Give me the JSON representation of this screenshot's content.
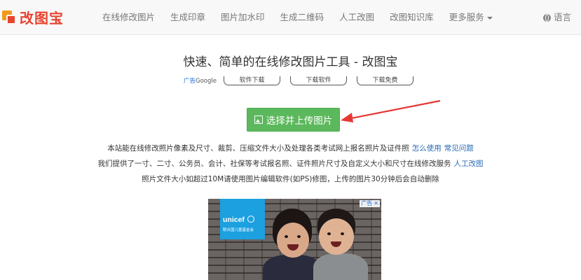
{
  "brand": {
    "logo_text": "改图宝",
    "logo_colors": [
      "#f39a1c",
      "#e8442f"
    ]
  },
  "nav": {
    "items": [
      "在线修改图片",
      "生成印章",
      "图片加水印",
      "生成二维码",
      "人工改图",
      "改图知识库",
      "更多服务"
    ],
    "language": "语言",
    "language_icon": "globe-icon"
  },
  "hero": {
    "title": "快速、简单的在线修改图片工具 - 改图宝"
  },
  "ads_row": {
    "google_prefix": "广告",
    "google_label": "Google",
    "pills": [
      "软件下载",
      "下载软件",
      "下载免费"
    ]
  },
  "upload": {
    "label": "选择并上传图片",
    "icon": "image-icon",
    "color": "#5cb85c"
  },
  "arrow_color": "#e53935",
  "info": {
    "line1_text": "本站能在线修改照片像素及尺寸、裁剪、压缩文件大小及处理各类考试网上报名照片及证件照",
    "line1_links": [
      "怎么使用",
      "常见问题"
    ],
    "line2_text": "我们提供了一寸、二寸、公务员、会计、社保等考试报名照、证件照片尺寸及自定义大小和尺寸在线修改服务",
    "line2_link": "人工改图",
    "line3_text": "照片文件大小如超过10M请使用图片编辑软件(如PS)修图，上传的图片30分钟后会自动删除",
    "link_color": "#2a6bb5"
  },
  "ad_image": {
    "brand_word": "unicef",
    "brand_sub": "联合国儿童基金会",
    "badge": "广告",
    "close": "✕",
    "brand_color": "#1ca0df"
  }
}
